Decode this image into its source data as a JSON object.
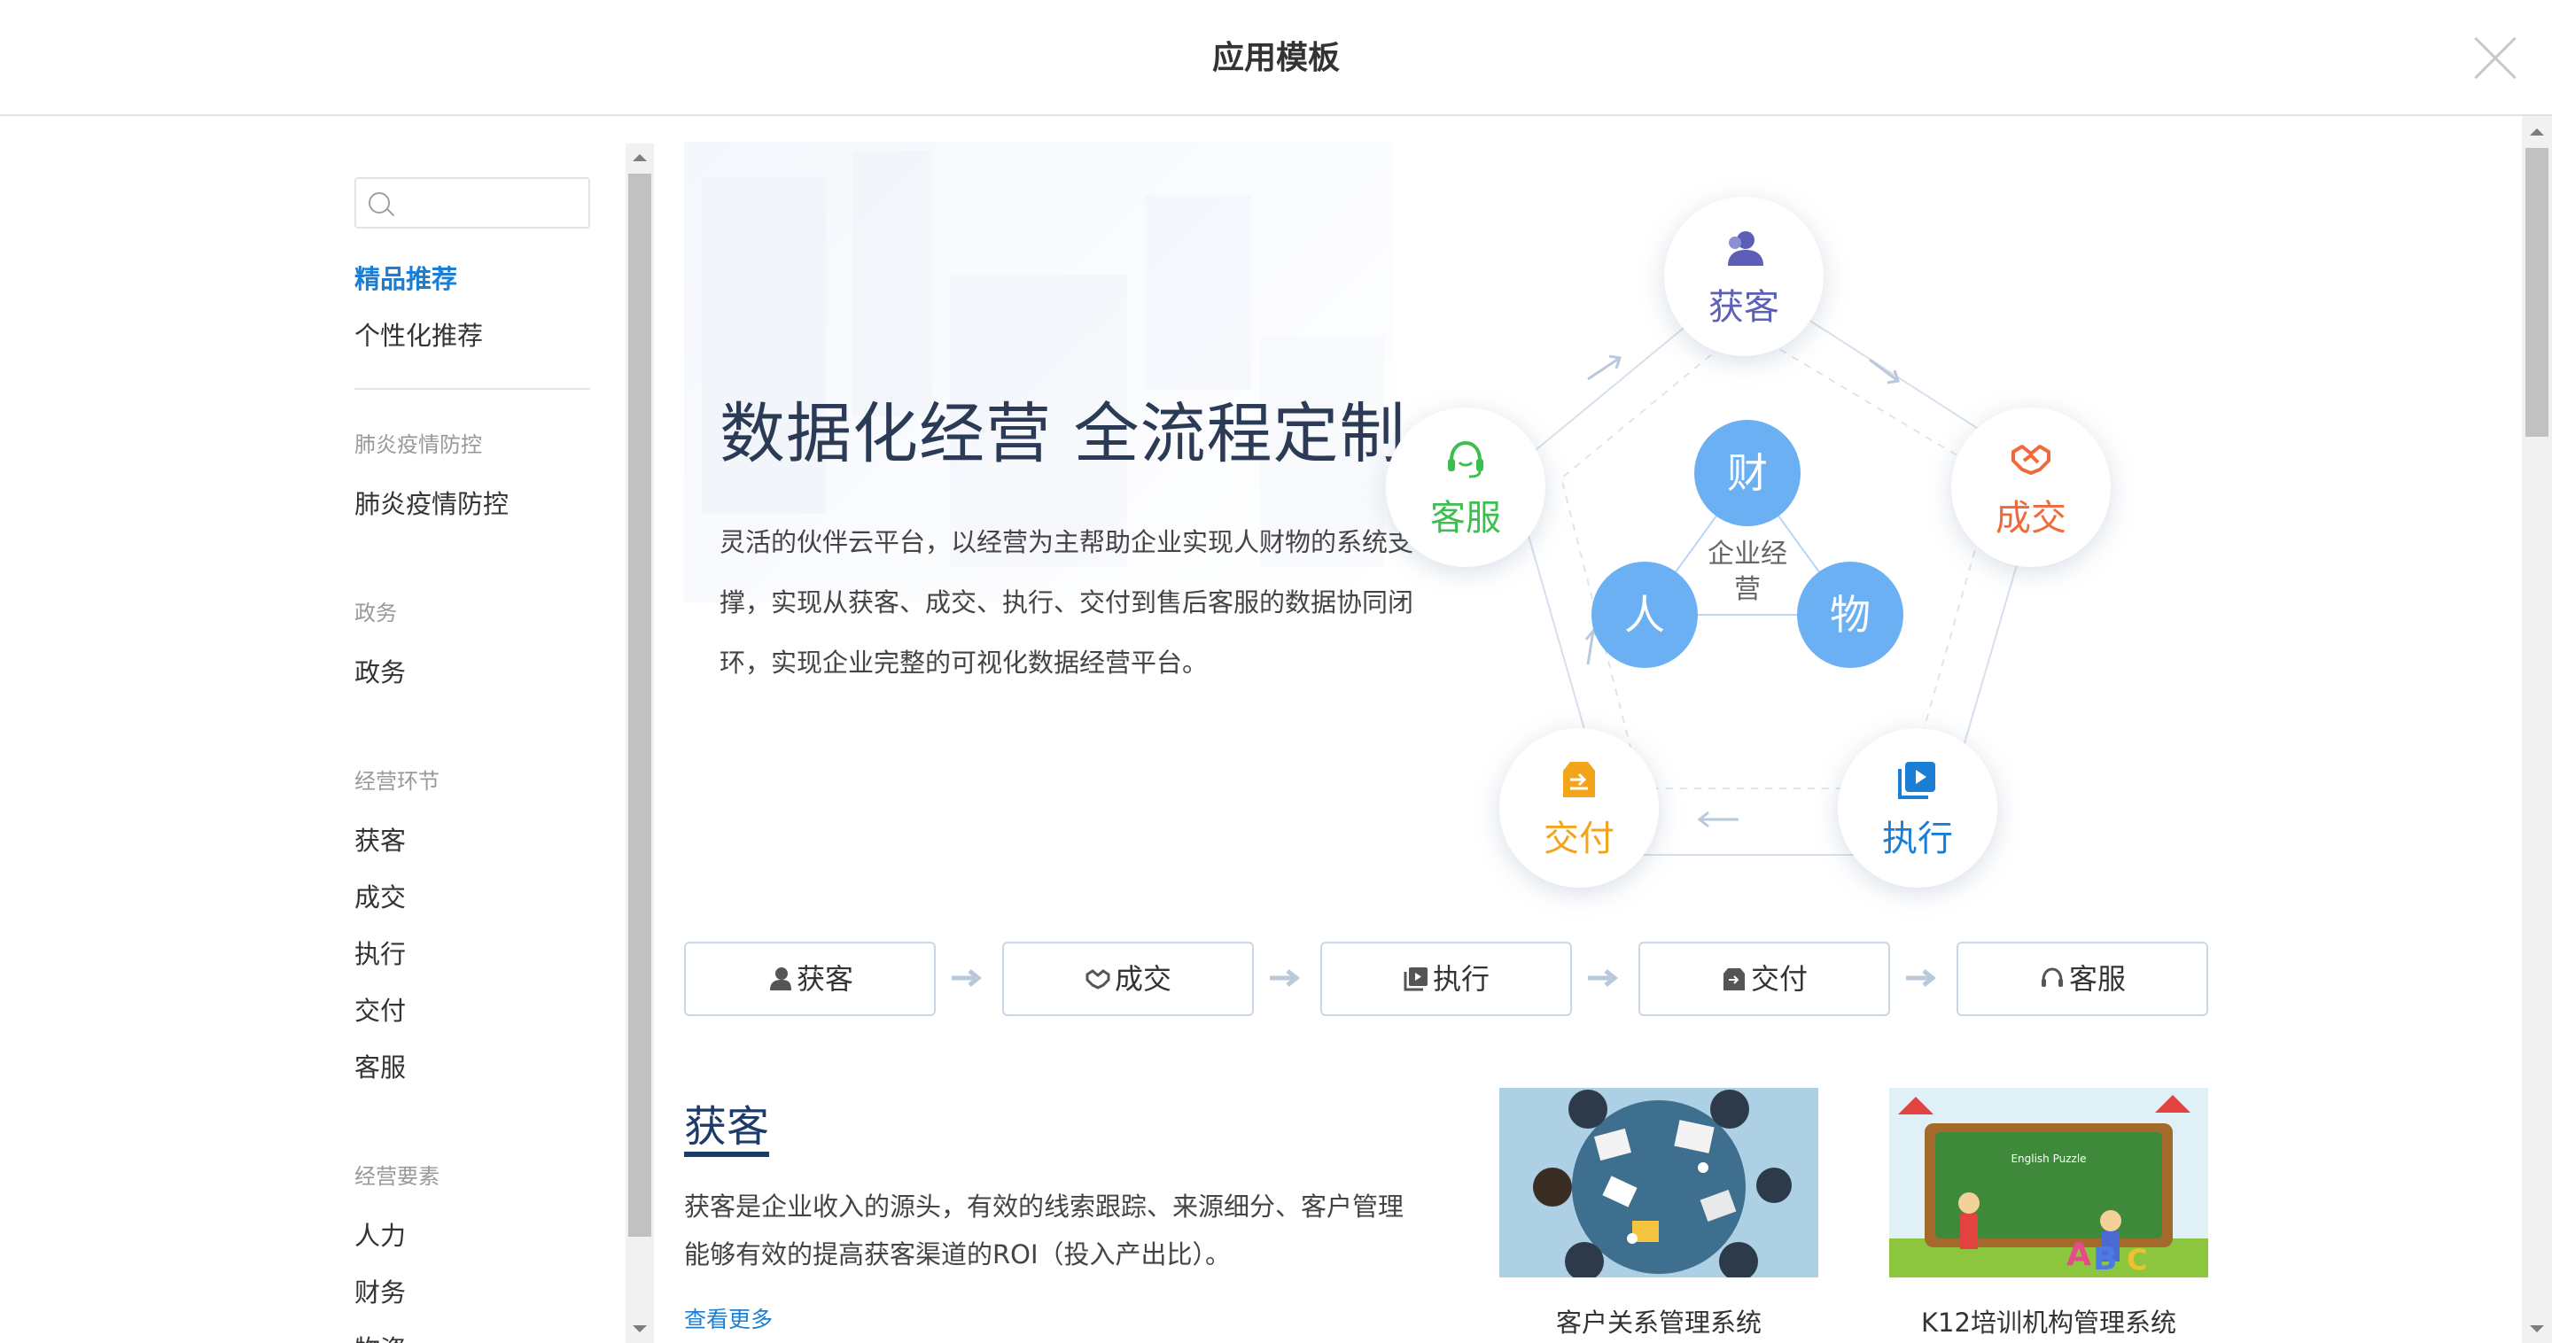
{
  "header": {
    "title": "应用模板"
  },
  "sidebar": {
    "search": {
      "placeholder": "",
      "value": ""
    },
    "featured": [
      {
        "label": "精品推荐",
        "active": true
      },
      {
        "label": "个性化推荐",
        "active": false
      }
    ],
    "groups": [
      {
        "heading": "肺炎疫情防控",
        "items": [
          "肺炎疫情防控"
        ]
      },
      {
        "heading": "政务",
        "items": [
          "政务"
        ]
      },
      {
        "heading": "经营环节",
        "items": [
          "获客",
          "成交",
          "执行",
          "交付",
          "客服"
        ]
      },
      {
        "heading": "经营要素",
        "items": [
          "人力",
          "财务",
          "物资"
        ]
      }
    ]
  },
  "hero": {
    "title": "数据化经营 全流程定制",
    "description": "灵活的伙伴云平台，以经营为主帮助企业实现人财物的系统支撑，实现从获客、成交、执行、交付到售后客服的数据协同闭环，实现企业完整的可视化数据经营平台。",
    "cycle": [
      {
        "label": "获客",
        "icon": "user-icon",
        "color": "#5b5fb8"
      },
      {
        "label": "成交",
        "icon": "handshake-icon",
        "color": "#ef6a3a"
      },
      {
        "label": "执行",
        "icon": "play-icon",
        "color": "#1a7fd4"
      },
      {
        "label": "交付",
        "icon": "box-icon",
        "color": "#f2a51a"
      },
      {
        "label": "客服",
        "icon": "headset-icon",
        "color": "#3cbf4e"
      }
    ],
    "core": {
      "items": [
        "财",
        "人",
        "物"
      ],
      "center": "企业经营",
      "color": "#6cb0f4"
    }
  },
  "steps": [
    {
      "label": "获客",
      "icon": "user-icon"
    },
    {
      "label": "成交",
      "icon": "handshake-icon"
    },
    {
      "label": "执行",
      "icon": "play-icon"
    },
    {
      "label": "交付",
      "icon": "box-icon"
    },
    {
      "label": "客服",
      "icon": "headset-icon"
    }
  ],
  "section": {
    "title": "获客",
    "description": "获客是企业收入的源头，有效的线索跟踪、来源细分、客户管理能够有效的提高获客渠道的ROI（投入产出比）。",
    "more": "查看更多",
    "cards": [
      {
        "name": "客户关系管理系统"
      },
      {
        "name": "K12培训机构管理系统",
        "image_text": "English Puzzle"
      }
    ]
  },
  "colors": {
    "accent": "#1a7fd4",
    "title": "#1d3b6a",
    "core": "#6cb0f4"
  }
}
